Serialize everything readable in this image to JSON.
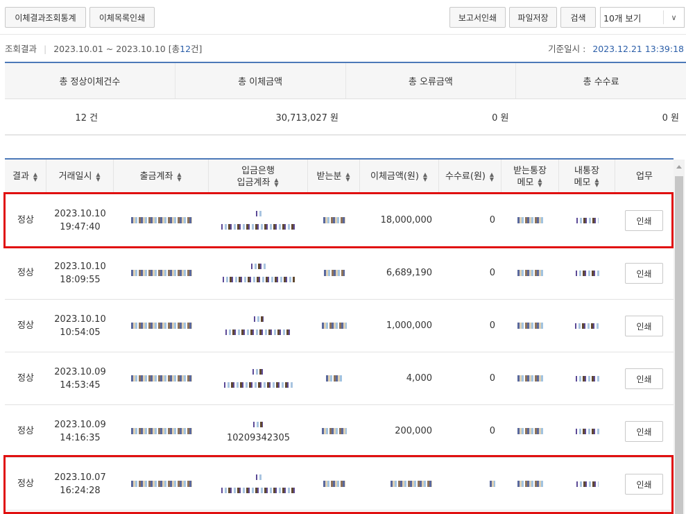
{
  "toolbar": {
    "stats_label": "이체결과조회통계",
    "list_print_label": "이체목록인쇄",
    "report_print_label": "보고서인쇄",
    "file_save_label": "파일저장",
    "search_label": "검색",
    "page_size": "10개 보기"
  },
  "info": {
    "result_label": "조회결과",
    "period": "2023.10.01 ~ 2023.10.10",
    "count_prefix": "[총",
    "count_value": "12",
    "count_suffix": "건]",
    "base_label": "기준일시 :",
    "base_datetime": "2023.12.21 13:39:18"
  },
  "summary": {
    "headers": [
      "총 정상이체건수",
      "총 이체금액",
      "총 오류금액",
      "총 수수료"
    ],
    "values": [
      "12 건",
      "30,713,027 원",
      "0 원",
      "0 원"
    ]
  },
  "grid": {
    "headers": {
      "result": "결과",
      "datetime": "거래일시",
      "out_account": "출금계좌",
      "in_bank_1": "입금은행",
      "in_bank_2": "입금계좌",
      "recipient": "받는분",
      "amount": "이체금액(원)",
      "fee": "수수료(원)",
      "memo_recv_1": "받는통장",
      "memo_recv_2": "메모",
      "memo_mine_1": "내통장",
      "memo_mine_2": "메모",
      "action": "업무"
    },
    "rows": [
      {
        "result": "정상",
        "date": "2023.10.10",
        "time": "19:47:40",
        "amount": "18,000,000",
        "fee": "0",
        "action": "인쇄"
      },
      {
        "result": "정상",
        "date": "2023.10.10",
        "time": "18:09:55",
        "amount": "6,689,190",
        "fee": "0",
        "action": "인쇄"
      },
      {
        "result": "정상",
        "date": "2023.10.10",
        "time": "10:54:05",
        "amount": "1,000,000",
        "fee": "0",
        "action": "인쇄"
      },
      {
        "result": "정상",
        "date": "2023.10.09",
        "time": "14:53:45",
        "amount": "4,000",
        "fee": "0",
        "action": "인쇄"
      },
      {
        "result": "정상",
        "date": "2023.10.09",
        "time": "14:16:35",
        "amount": "200,000",
        "fee": "0",
        "action": "인쇄",
        "account_partial": "10209342305"
      },
      {
        "result": "정상",
        "date": "2023.10.07",
        "time": "16:24:28",
        "amount": "",
        "fee": "",
        "action": "인쇄"
      }
    ]
  },
  "colors": {
    "accent": "#4c78b8",
    "highlight": "#e01010",
    "text_blue": "#2b5ea8"
  }
}
